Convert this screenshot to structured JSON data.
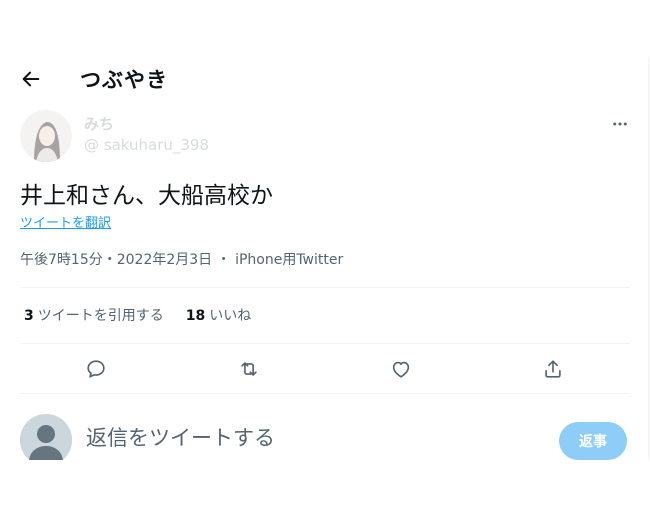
{
  "header": {
    "title": "つぶやき",
    "back_icon": "arrow-left-icon"
  },
  "author": {
    "display_name": "みち",
    "handle": "@ sakuharu_398",
    "more_icon": "ellipsis-icon"
  },
  "tweet": {
    "text": "井上和さん、大船高校か",
    "translate_label": "ツイートを翻訳",
    "meta": "午後7時15分・2022年2月3日 ・ iPhone用Twitter"
  },
  "stats": {
    "quotes_count": "3",
    "quotes_label": "ツイートを引用する",
    "likes_count": "18",
    "likes_label": "いいね"
  },
  "actions": [
    "reply-icon",
    "retweet-icon",
    "like-icon",
    "share-icon"
  ],
  "reply": {
    "placeholder": "返信をツイートする",
    "button_label": "返事"
  },
  "colors": {
    "accent": "#1d9bf0",
    "button_disabled": "#8ecdf8",
    "secondary_text": "#536471",
    "divider": "#eff3f4"
  }
}
